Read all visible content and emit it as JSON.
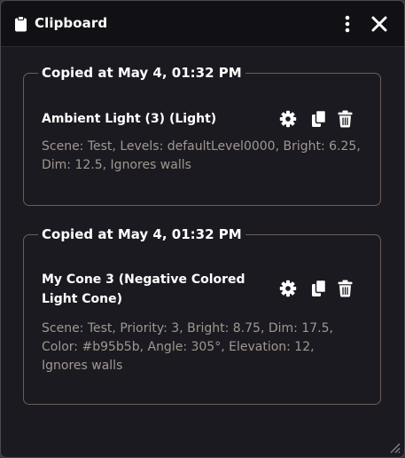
{
  "window": {
    "title": "Clipboard",
    "title_icon": "clipboard-icon",
    "menu_icon": "vertical-ellipsis-icon",
    "close_icon": "close-icon"
  },
  "entries": [
    {
      "header": "Copied at May 4, 01:32 PM",
      "name": "Ambient Light (3) (Light)",
      "description": "Scene: Test, Levels: defaultLevel0000, Bright: 6.25, Dim: 12.5, Ignores walls",
      "actions": [
        "gear-icon",
        "copy-icon",
        "trash-icon"
      ]
    },
    {
      "header": "Copied at May 4, 01:32 PM",
      "name": "My Cone 3 (Negative Colored Light Cone)",
      "description": "Scene: Test, Priority: 3, Bright: 8.75, Dim: 17.5, Color: #b95b5b, Angle: 305°, Elevation: 12, Ignores walls",
      "actions": [
        "gear-icon",
        "copy-icon",
        "trash-icon"
      ]
    }
  ],
  "colors": {
    "window_bg": "#1b1a20",
    "titlebar_bg": "#111014",
    "border": "#6b5e58",
    "text_primary": "#ffffff",
    "text_secondary": "#a09891"
  }
}
